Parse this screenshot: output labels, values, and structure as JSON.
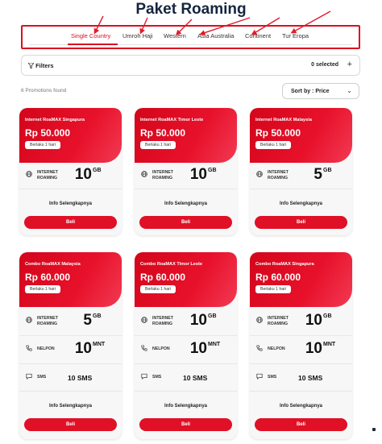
{
  "page_title": "Paket Roaming",
  "tabs": [
    {
      "label": "Single Country",
      "active": true
    },
    {
      "label": "Umroh Haji",
      "active": false
    },
    {
      "label": "Western",
      "active": false
    },
    {
      "label": "Asia Australia",
      "active": false
    },
    {
      "label": "Continent",
      "active": false
    },
    {
      "label": "Tur Eropa",
      "active": false
    }
  ],
  "filters": {
    "label": "Filters",
    "selected": "0 selected",
    "add": "+"
  },
  "results": {
    "found": "6 Promotions found"
  },
  "sort": {
    "label": "Sort by : Price",
    "chevron": "⌄"
  },
  "colors": {
    "accent": "#d91020",
    "card_bg": "#f7f7f7",
    "arrow": "#e21b2a"
  },
  "cards": [
    {
      "name": "Internet RoaMAX Singapura",
      "price": "Rp 50.000",
      "validity": "Berlaku 1 hari",
      "internet": {
        "label_1": "INTERNET",
        "label_2": "ROAMING",
        "value": "10",
        "unit": "GB"
      },
      "info": "Info Selengkapnya",
      "buy": "Beli"
    },
    {
      "name": "Internet RoaMAX Timor Leste",
      "price": "Rp 50.000",
      "validity": "Berlaku 1 hari",
      "internet": {
        "label_1": "INTERNET",
        "label_2": "ROAMING",
        "value": "10",
        "unit": "GB"
      },
      "info": "Info Selengkapnya",
      "buy": "Beli"
    },
    {
      "name": "Internet RoaMAX Malaysia",
      "price": "Rp 50.000",
      "validity": "Berlaku 1 hari",
      "internet": {
        "label_1": "INTERNET",
        "label_2": "ROAMING",
        "value": "5",
        "unit": "GB"
      },
      "info": "Info Selengkapnya",
      "buy": "Beli"
    },
    {
      "name": "Combo RoaMAX Malaysia",
      "price": "Rp 60.000",
      "validity": "Berlaku 1 hari",
      "internet": {
        "label_1": "INTERNET",
        "label_2": "ROAMING",
        "value": "5",
        "unit": "GB"
      },
      "call": {
        "label": "NELPON",
        "value": "10",
        "unit": "MNT"
      },
      "sms": {
        "label": "SMS",
        "value": "10 SMS"
      },
      "info": "Info Selengkapnya",
      "buy": "Beli"
    },
    {
      "name": "Combo RoaMAX Timor Leste",
      "price": "Rp 60.000",
      "validity": "Berlaku 1 hari",
      "internet": {
        "label_1": "INTERNET",
        "label_2": "ROAMING",
        "value": "10",
        "unit": "GB"
      },
      "call": {
        "label": "NELPON",
        "value": "10",
        "unit": "MNT"
      },
      "sms": {
        "label": "SMS",
        "value": "10 SMS"
      },
      "info": "Info Selengkapnya",
      "buy": "Beli"
    },
    {
      "name": "Combo RoaMAX Singapura",
      "price": "Rp 60.000",
      "validity": "Berlaku 1 hari",
      "internet": {
        "label_1": "INTERNET",
        "label_2": "ROAMING",
        "value": "10",
        "unit": "GB"
      },
      "call": {
        "label": "NELPON",
        "value": "10",
        "unit": "MNT"
      },
      "sms": {
        "label": "SMS",
        "value": "10 SMS"
      },
      "info": "Info Selengkapnya",
      "buy": "Beli"
    }
  ],
  "icons": {
    "internet": "globe-icon",
    "call": "phone-icon",
    "sms": "message-icon",
    "filter": "funnel-icon",
    "arrow": "annotation-arrow"
  }
}
